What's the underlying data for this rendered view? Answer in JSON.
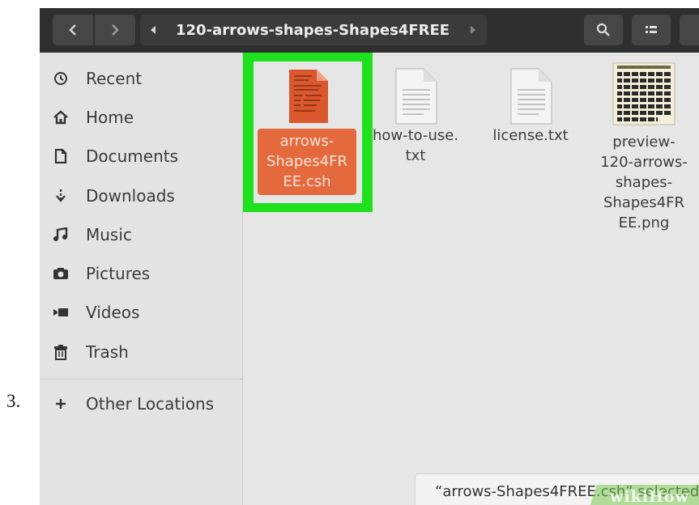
{
  "step": {
    "number": "3."
  },
  "headerbar": {
    "back_icon": "chevron-left-icon",
    "forward_icon": "chevron-right-icon",
    "path_back_icon": "triangle-left-icon",
    "path_label": "120-arrows-shapes-Shapes4FREE",
    "path_forward_icon": "triangle-right-icon",
    "search_icon": "search-icon",
    "view_icon": "list-view-icon"
  },
  "sidebar": {
    "items": [
      {
        "label": "Recent",
        "icon": "clock-icon"
      },
      {
        "label": "Home",
        "icon": "home-icon"
      },
      {
        "label": "Documents",
        "icon": "document-icon"
      },
      {
        "label": "Downloads",
        "icon": "download-icon"
      },
      {
        "label": "Music",
        "icon": "music-icon"
      },
      {
        "label": "Pictures",
        "icon": "camera-icon"
      },
      {
        "label": "Videos",
        "icon": "video-icon"
      },
      {
        "label": "Trash",
        "icon": "trash-icon"
      }
    ],
    "other": {
      "label": "Other Locations",
      "icon": "plus-icon"
    }
  },
  "files": [
    {
      "name": "arrows-Shapes4FREE.csh",
      "lines": [
        "arrows-",
        "Shapes4FR",
        "EE.csh"
      ],
      "selected": true,
      "icon": "csh-file-icon"
    },
    {
      "name": "how-to-use.txt",
      "lines": [
        "how-to-use.",
        "txt"
      ],
      "selected": false,
      "icon": "text-file-icon"
    },
    {
      "name": "license.txt",
      "lines": [
        "license.txt"
      ],
      "selected": false,
      "icon": "text-file-icon"
    },
    {
      "name": "preview-120-arrows-shapes-Shapes4FREE.png",
      "lines": [
        "preview-",
        "120-arrows-",
        "shapes-",
        "Shapes4FR",
        "EE.png"
      ],
      "selected": false,
      "icon": "image-thumbnail-icon"
    }
  ],
  "status": {
    "text": "“arrows-Shapes4FREE.csh” selected"
  },
  "watermark": {
    "text": "wikiHow"
  },
  "colors": {
    "highlight": "#1ee11e",
    "selection": "#e46a3d",
    "headerbar": "#2f2f2f",
    "sidebar": "#e3e3e3"
  }
}
